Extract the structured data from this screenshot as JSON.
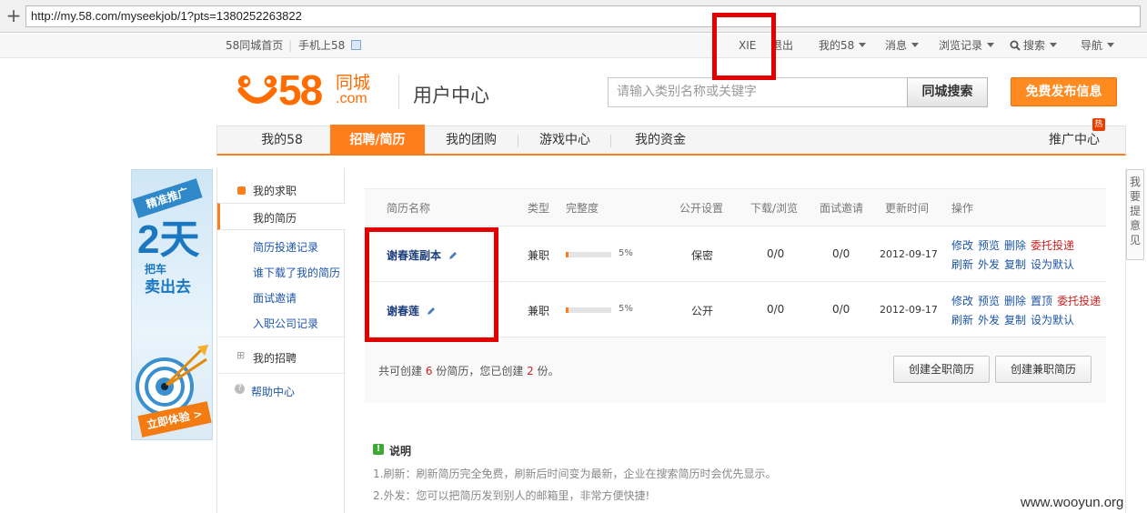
{
  "browser": {
    "url": "http://my.58.com/myseekjob/1?pts=1380252263822",
    "new_tab_icon": "plus-icon"
  },
  "topnav": {
    "home": "58同城首页",
    "mobile": "手机上58",
    "username": "XIE",
    "logout": "退出",
    "my58": "我的58",
    "messages": "消息",
    "history": "浏览记录",
    "search": "搜索",
    "nav": "导航"
  },
  "header": {
    "logo_number": "58",
    "logo_cn": "同城",
    "logo_com": ".com",
    "title": "用户中心",
    "search_placeholder": "请输入类别名称或关键字",
    "search_button": "同城搜索",
    "post_button": "免费发布信息"
  },
  "tabs": {
    "my58": "我的58",
    "jobs": "招聘/简历",
    "groupbuy": "我的团购",
    "games": "游戏中心",
    "funds": "我的资金",
    "promo": "推广中心",
    "hot_badge": "热"
  },
  "ad": {
    "tag": "精准推广",
    "big": "2天",
    "line1": "把车",
    "line2": "卖出去",
    "cta": "立即体验 >"
  },
  "sidebar": {
    "my_jobs": "我的求职",
    "my_resume": "我的简历",
    "applications": "简历投递记录",
    "downloads": "谁下载了我的简历",
    "interviews": "面试邀请",
    "hired": "入职公司记录",
    "my_hiring": "我的招聘",
    "help": "帮助中心"
  },
  "feedback": [
    "我",
    "要",
    "提",
    "意",
    "见"
  ],
  "table": {
    "headers": [
      "简历名称",
      "类型",
      "完整度",
      "公开设置",
      "下载/浏览",
      "面试邀请",
      "更新时间",
      "操作"
    ],
    "rows": [
      {
        "name": "谢春莲副本",
        "type": "兼职",
        "completeness": 0.05,
        "completeness_label": "5%",
        "visibility": "保密",
        "downloads": "0/0",
        "interviews": "0/0",
        "updated": "2012-09-17",
        "ops1": [
          "修改",
          "预览",
          "删除"
        ],
        "op_red": "委托投递",
        "ops2": [
          "刷新",
          "外发",
          "复制",
          "设为默认"
        ]
      },
      {
        "name": "谢春莲",
        "type": "兼职",
        "completeness": 0.05,
        "completeness_label": "5%",
        "visibility": "公开",
        "downloads": "0/0",
        "interviews": "0/0",
        "updated": "2012-09-17",
        "ops1": [
          "修改",
          "预览",
          "删除",
          "置顶"
        ],
        "op_red": "委托投递",
        "ops2": [
          "刷新",
          "外发",
          "复制",
          "设为默认"
        ]
      }
    ],
    "summary_a": "共可创建",
    "summary_total": "6",
    "summary_b": "份简历，您已创建",
    "summary_created": "2",
    "summary_c": "份。",
    "btn_fulltime": "创建全职简历",
    "btn_parttime": "创建兼职简历"
  },
  "notes": {
    "title": "说明",
    "items": [
      "1.刷新：刷新简历完全免费，刷新后时间变为最新，企业在搜索简历时会优先显示。",
      "2.外发：您可以把简历发到别人的邮箱里，非常方便快捷!"
    ]
  },
  "watermark": "www.wooyun.org",
  "colors": {
    "brand_orange": "#ff7e1b",
    "annotation_red": "#e50000",
    "link_blue": "#1e55a8"
  }
}
